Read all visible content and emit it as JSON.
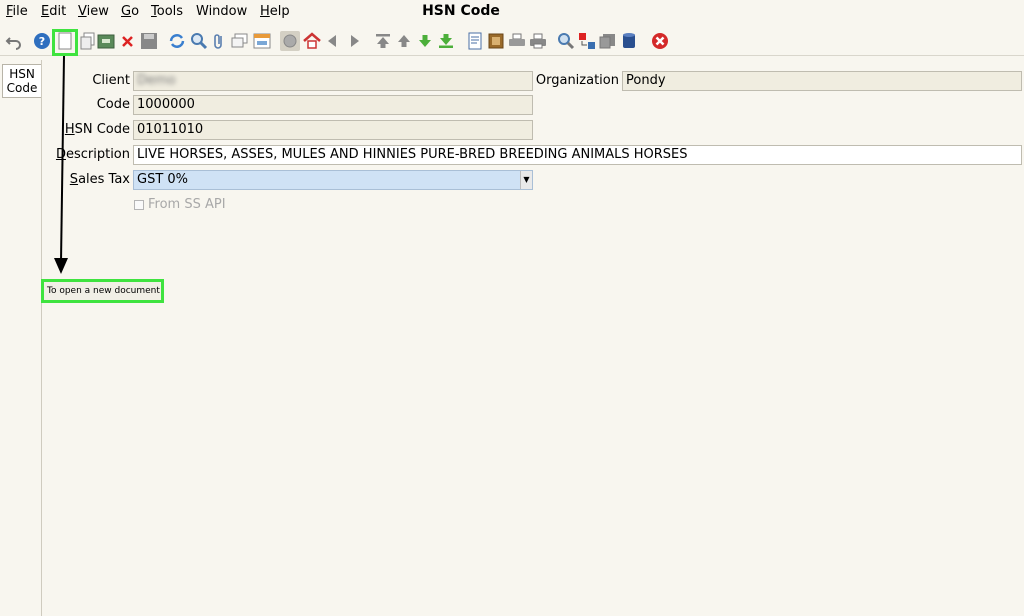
{
  "menu": {
    "items": [
      {
        "key": "F",
        "rest": "ile"
      },
      {
        "key": "E",
        "rest": "dit"
      },
      {
        "key": "V",
        "rest": "iew"
      },
      {
        "key": "G",
        "rest": "o"
      },
      {
        "key": "T",
        "rest": "ools"
      },
      {
        "key": "",
        "rest": "Window"
      },
      {
        "key": "H",
        "rest": "elp"
      }
    ]
  },
  "window_title": "HSN Code",
  "left_tab": {
    "line1": "HSN",
    "line2": "Code"
  },
  "form": {
    "client_label": "Client",
    "client_value": "Demo",
    "organization_label": "Organization",
    "organization_value": "Pondy",
    "code_label": "Code",
    "code_value": "1000000",
    "hsn_label_key": "H",
    "hsn_label_rest": "SN Code",
    "hsn_value": "01011010",
    "description_label_key": "D",
    "description_label_rest": "escription",
    "description_value": "LIVE HORSES, ASSES, MULES AND HINNIES PURE-BRED BREEDING ANIMALS HORSES",
    "sales_tax_label_key": "S",
    "sales_tax_label_rest": "ales Tax",
    "sales_tax_value": "GST 0%",
    "from_ss_api_label": "From SS API"
  },
  "annotation": {
    "tooltip_text": "To open a new document",
    "highlight_color": "#3fe33f"
  },
  "icons": [
    "undo-icon",
    "help-icon",
    "new-record-icon",
    "copy-record-icon",
    "archive-icon",
    "delete-icon",
    "save-icon",
    "refresh-icon",
    "find-icon",
    "attachment-icon",
    "chat-icon",
    "history-icon",
    "grid-toggle-icon",
    "home-icon",
    "previous-icon",
    "next-icon",
    "first-record-icon",
    "previous-record-icon",
    "next-record-icon",
    "last-record-icon",
    "report-icon",
    "archived-docs-icon",
    "print-preview-icon",
    "print-icon",
    "zoom-across-icon",
    "workflow-icon",
    "request-icon",
    "product-info-icon",
    "close-window-icon"
  ]
}
